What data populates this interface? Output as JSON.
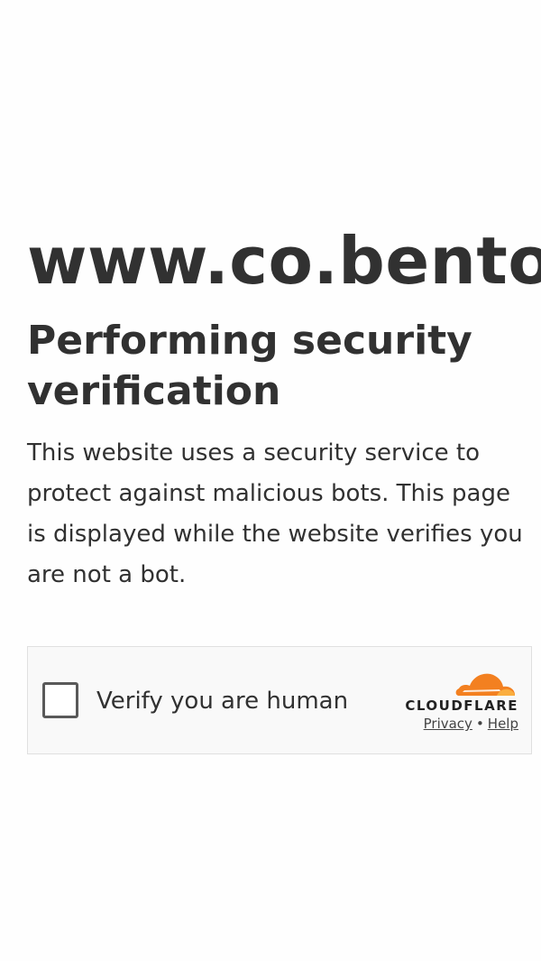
{
  "page": {
    "domain_title": "www.co.bento",
    "heading": "Performing security verification",
    "description": "This website uses a security service to protect against malicious bots. This page is displayed while the website verifies you are not a bot."
  },
  "challenge_widget": {
    "checkbox_label": "Verify you are human",
    "brand": "CLOUDFLARE",
    "privacy_link": "Privacy",
    "separator": "•",
    "help_link": "Help",
    "colors": {
      "brand_orange": "#f38020",
      "brand_orange_light": "#faae40",
      "widget_background": "#f9f9f9",
      "widget_border": "#e0e0e0"
    }
  }
}
